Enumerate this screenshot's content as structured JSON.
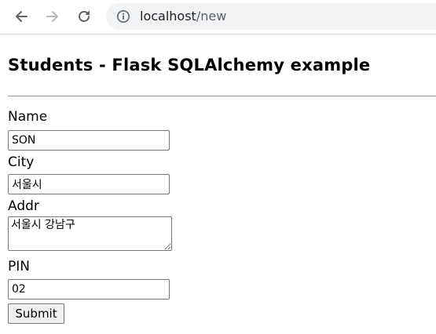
{
  "browser": {
    "url_host": "localhost",
    "url_path": "/new"
  },
  "page": {
    "title": "Students - Flask SQLAlchemy example"
  },
  "form": {
    "name_label": "Name",
    "name_value": "SON",
    "city_label": "City",
    "city_value": "서울시",
    "addr_label": "Addr",
    "addr_value": "서울시 강남구",
    "pin_label": "PIN",
    "pin_value": "02",
    "submit_label": "Submit"
  },
  "icons": {
    "back": "back-arrow-icon",
    "forward": "forward-arrow-icon",
    "reload": "reload-icon",
    "info": "info-icon"
  }
}
